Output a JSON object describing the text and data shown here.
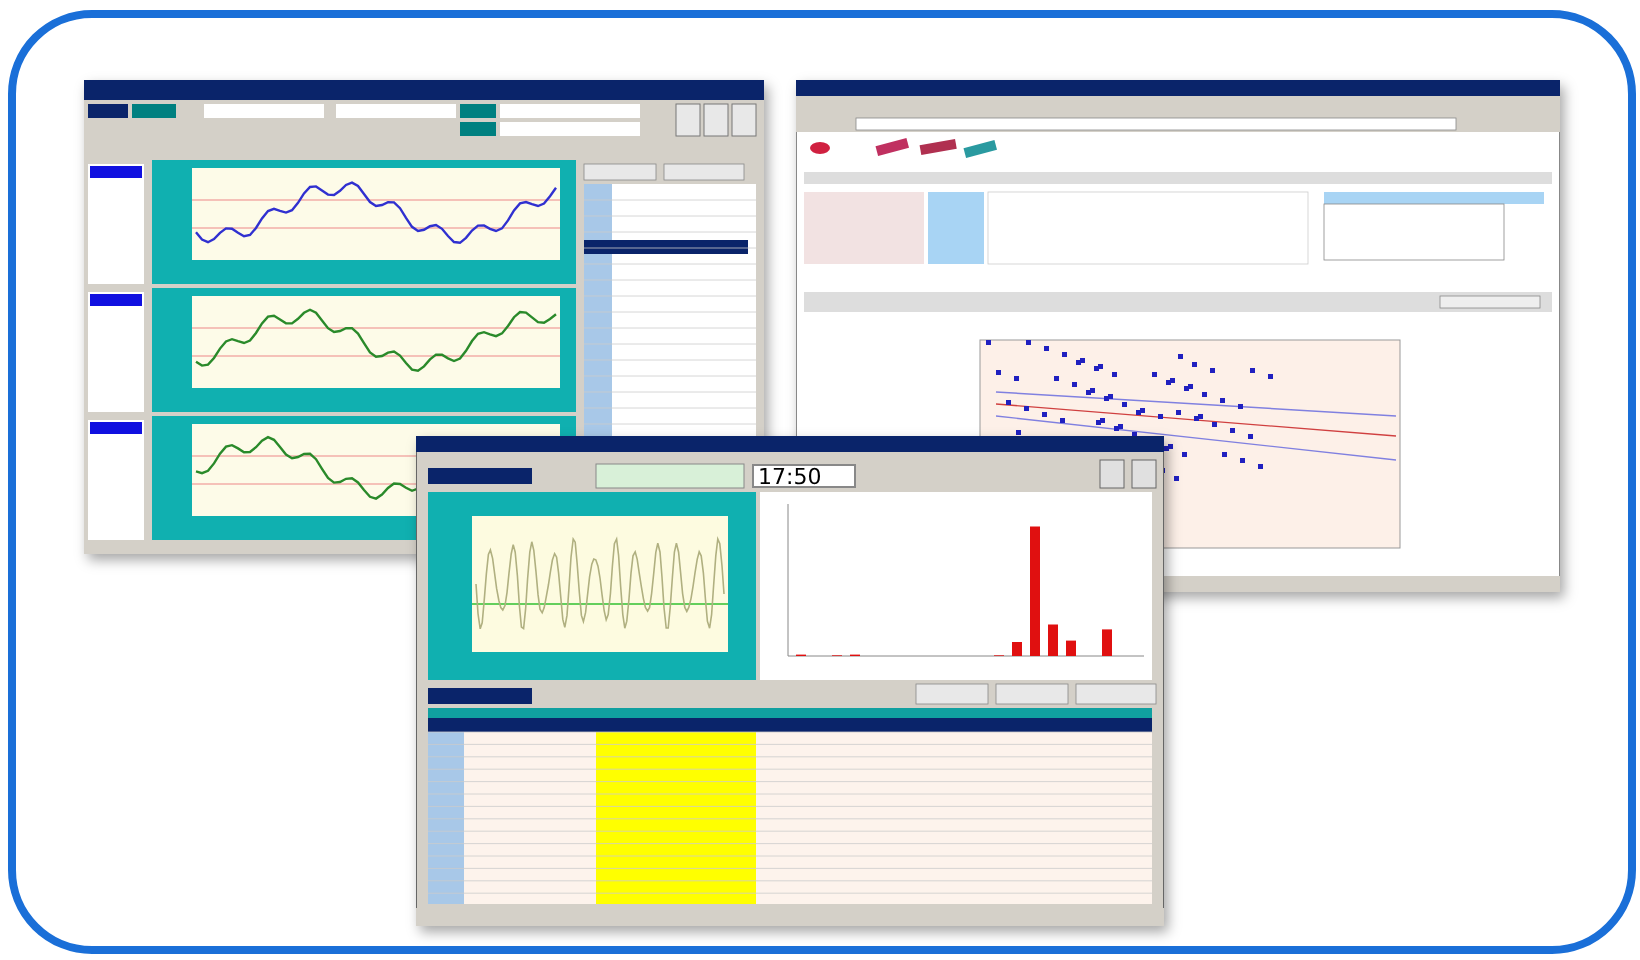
{
  "windows": [
    {
      "kind": "trend"
    },
    {
      "kind": "scatter"
    },
    {
      "kind": "histogram",
      "time_field": {
        "value": "17:50"
      }
    }
  ]
}
